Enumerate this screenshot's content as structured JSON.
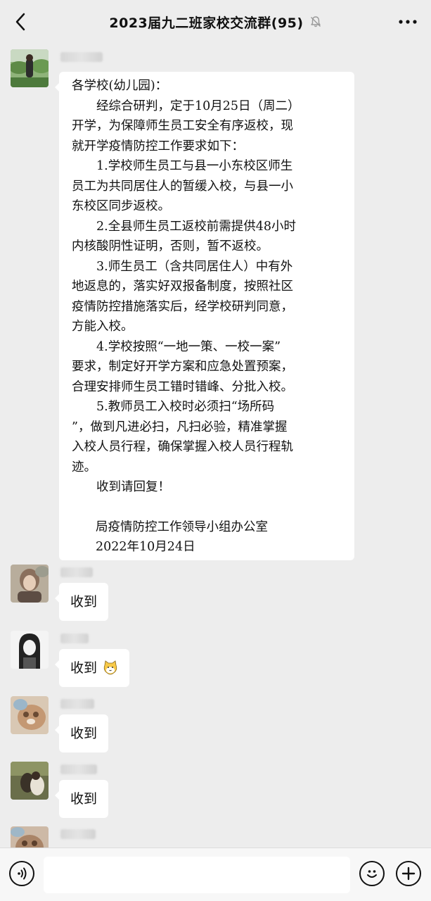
{
  "header": {
    "title": "2023届九二班家校交流群(95)",
    "muted": true
  },
  "messages": [
    {
      "type": "notice",
      "lines": [
        {
          "text": "各学校(幼儿园)：",
          "indent": false
        },
        {
          "text": "经综合研判，定于10月25日（周二）",
          "indent": true
        },
        {
          "text": "开学，为保障师生员工安全有序返校，现",
          "indent": false
        },
        {
          "text": "就开学疫情防控工作要求如下：",
          "indent": false
        },
        {
          "text": "1.学校师生员工与县一小东校区师生",
          "indent": true
        },
        {
          "text": "员工为共同居住人的暂缓入校，与县一小",
          "indent": false
        },
        {
          "text": "东校区同步返校。",
          "indent": false
        },
        {
          "text": "2.全县师生员工返校前需提供48小时",
          "indent": true
        },
        {
          "text": "内核酸阴性证明，否则，暂不返校。",
          "indent": false
        },
        {
          "text": "3.师生员工（含共同居住人）中有外",
          "indent": true
        },
        {
          "text": "地返息的，落实好双报备制度，按照社区",
          "indent": false
        },
        {
          "text": "疫情防控措施落实后，经学校研判同意，",
          "indent": false
        },
        {
          "text": "方能入校。",
          "indent": false
        },
        {
          "text": "4.学校按照“一地一策、一校一案”",
          "indent": true
        },
        {
          "text": "要求，制定好开学方案和应急处置预案，",
          "indent": false
        },
        {
          "text": "合理安排师生员工错时错峰、分批入校。",
          "indent": false
        },
        {
          "text": "5.教师员工入校时必须扫“场所码",
          "indent": true
        },
        {
          "text": "”，做到凡进必扫，凡扫必验，精准掌握",
          "indent": false
        },
        {
          "text": "入校人员行程，确保掌握入校人员行程轨",
          "indent": false
        },
        {
          "text": "迹。",
          "indent": false
        },
        {
          "text": "收到请回复！",
          "indent": true
        }
      ],
      "signature": {
        "office": "局疫情防控工作领导小组办公室",
        "date": "2022年10月24日"
      }
    },
    {
      "type": "text",
      "text": "收到",
      "emoji": ""
    },
    {
      "type": "text",
      "text": "收到",
      "emoji": "cat-face"
    },
    {
      "type": "text",
      "text": "收到",
      "emoji": ""
    },
    {
      "type": "text",
      "text": "收到",
      "emoji": ""
    }
  ],
  "input_bar": {
    "placeholder": "",
    "icons": [
      "voice-icon",
      "emoji-icon",
      "plus-icon"
    ]
  },
  "colors": {
    "background": "#ededed",
    "bubble": "#ffffff",
    "input_bar": "#f7f7f7"
  }
}
